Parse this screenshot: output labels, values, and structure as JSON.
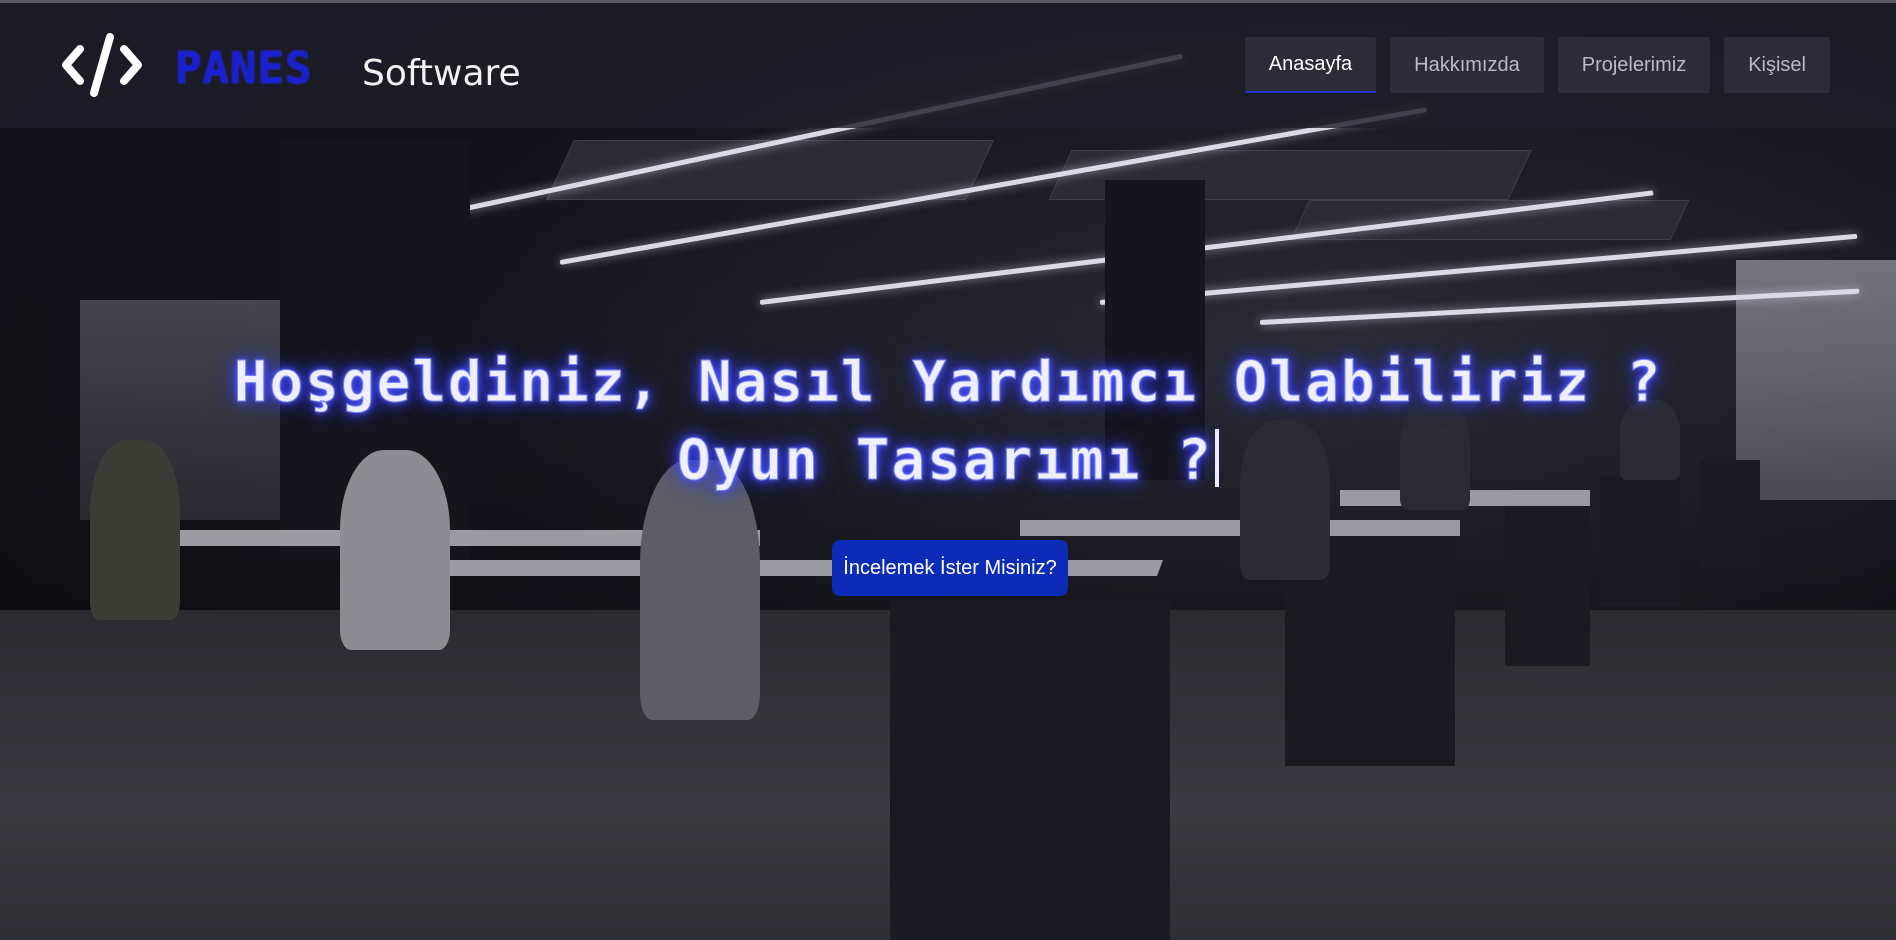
{
  "header": {
    "brand_name": "PANES",
    "brand_suffix": "Software",
    "logo_icon": "code-brackets-icon",
    "nav": [
      {
        "label": "Anasayfa",
        "active": true
      },
      {
        "label": "Hakkımızda",
        "active": false
      },
      {
        "label": "Projelerimiz",
        "active": false
      },
      {
        "label": "Kişisel",
        "active": false
      }
    ]
  },
  "hero": {
    "title_line1": "Hoşgeldiniz, Nasıl Yardımcı Olabiliriz ?",
    "title_line2": "Oyun Tasarımı ?",
    "cta_label": "İncelemek İster Misiniz?"
  },
  "colors": {
    "brand_blue": "#1a1fd0",
    "cta_blue": "#0c2cb8",
    "neon_glow": "#3b44ff",
    "nav_active_underline": "#2530c8"
  }
}
